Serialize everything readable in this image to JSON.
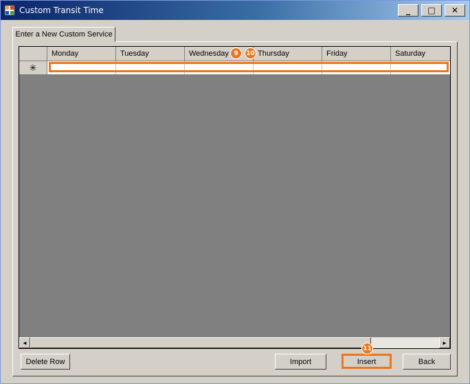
{
  "window": {
    "title": "Custom Transit Time",
    "minimize": "_",
    "maximize": "□",
    "close": "✕"
  },
  "tab": {
    "label": "Enter a New Custom Service"
  },
  "grid": {
    "columns": [
      "Monday",
      "Tuesday",
      "Wednesday",
      "Thursday",
      "Friday",
      "Saturday"
    ],
    "new_row_marker": "✳"
  },
  "buttons": {
    "delete_row": "Delete Row",
    "import": "Import",
    "insert": "Insert",
    "back": "Back"
  },
  "callouts": [
    "9",
    "10",
    "11"
  ],
  "highlight_color": "#e87722",
  "icons": {
    "app": "app-window-icon",
    "scroll_left": "◄",
    "scroll_right": "►"
  }
}
